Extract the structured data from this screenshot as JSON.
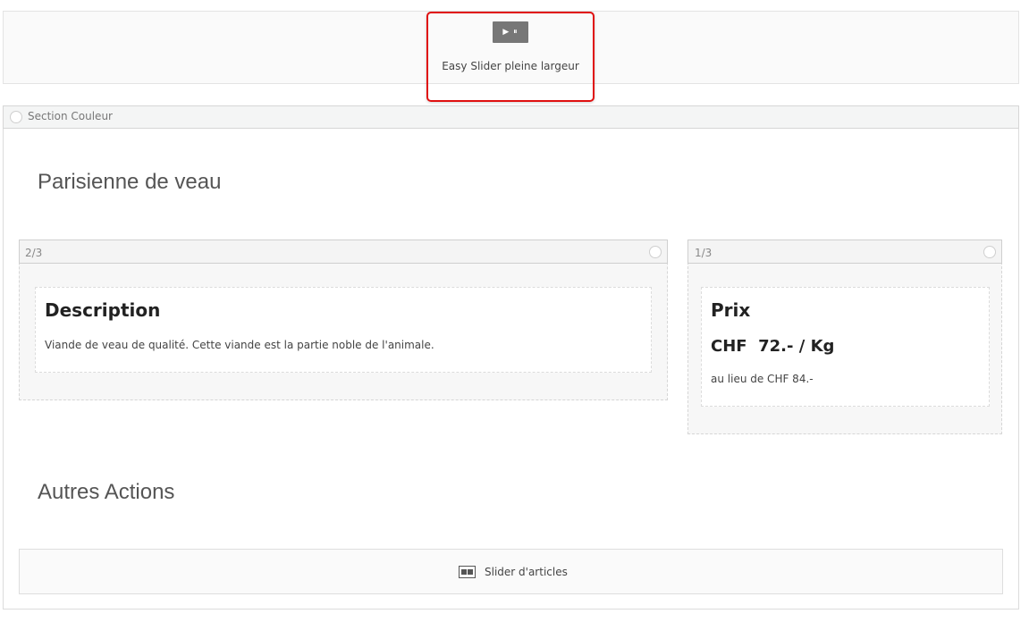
{
  "slider": {
    "icon": "play-pause-icon",
    "icon_glyph": "▶ ⏸",
    "label": "Easy Slider pleine largeur",
    "highlight_color": "#e01010"
  },
  "section": {
    "label": "Section Couleur",
    "title": "Parisienne de veau",
    "columns": [
      {
        "label": "2/3",
        "card": {
          "title": "Description",
          "text": "Viande de veau de qualité. Cette viande est la partie noble de l'animale."
        }
      },
      {
        "label": "1/3",
        "card": {
          "title": "Prix",
          "price": "CHF  72.- / Kg",
          "note": "au lieu de CHF 84.-"
        }
      }
    ],
    "other_title": "Autres Actions",
    "articles_slider": {
      "icon": "slider-layout-icon",
      "label": "Slider d'articles"
    }
  }
}
